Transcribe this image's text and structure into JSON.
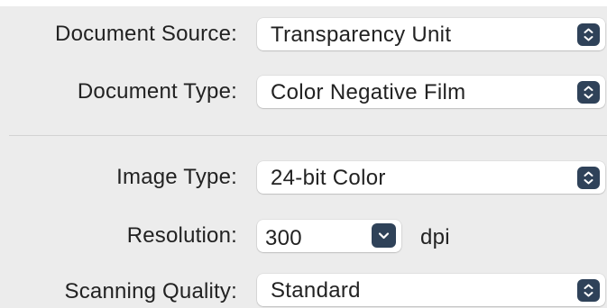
{
  "form": {
    "document_source": {
      "label": "Document Source:",
      "value": "Transparency Unit",
      "control": "popup",
      "icon": "up-down-chevron-icon"
    },
    "document_type": {
      "label": "Document Type:",
      "value": "Color Negative Film",
      "control": "popup",
      "icon": "up-down-chevron-icon"
    },
    "image_type": {
      "label": "Image Type:",
      "value": "24-bit Color",
      "control": "popup",
      "icon": "up-down-chevron-icon"
    },
    "resolution": {
      "label": "Resolution:",
      "value": "300",
      "unit": "dpi",
      "control": "combo-box",
      "icon": "chevron-down-icon"
    },
    "scanning_quality": {
      "label": "Scanning Quality:",
      "value": "Standard",
      "control": "popup",
      "icon": "up-down-chevron-icon"
    }
  },
  "colors": {
    "panel_background": "#ececec",
    "control_background": "#ffffff",
    "accent_button": "#2f4259",
    "text": "#222222",
    "divider": "#d3d3d3"
  }
}
